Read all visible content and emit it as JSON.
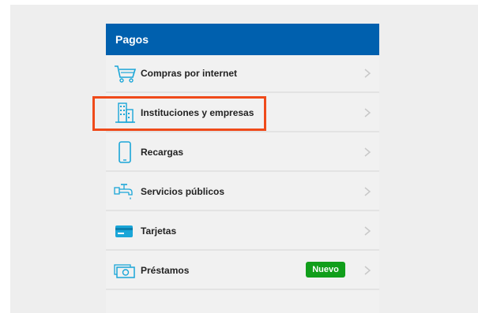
{
  "panel": {
    "title": "Pagos",
    "items": [
      {
        "label": "Compras por internet",
        "icon": "shopping-cart-icon"
      },
      {
        "label": "Instituciones y empresas",
        "icon": "building-icon"
      },
      {
        "label": "Recargas",
        "icon": "smartphone-icon"
      },
      {
        "label": "Servicios públicos",
        "icon": "water-faucet-icon"
      },
      {
        "label": "Tarjetas",
        "icon": "credit-card-icon"
      },
      {
        "label": "Préstamos",
        "icon": "cash-loan-icon",
        "badge": "Nuevo"
      }
    ]
  },
  "colors": {
    "header": "#0060ae",
    "icon": "#1aa6d8",
    "badge": "#119e1b",
    "highlight": "#ef4a1a"
  }
}
